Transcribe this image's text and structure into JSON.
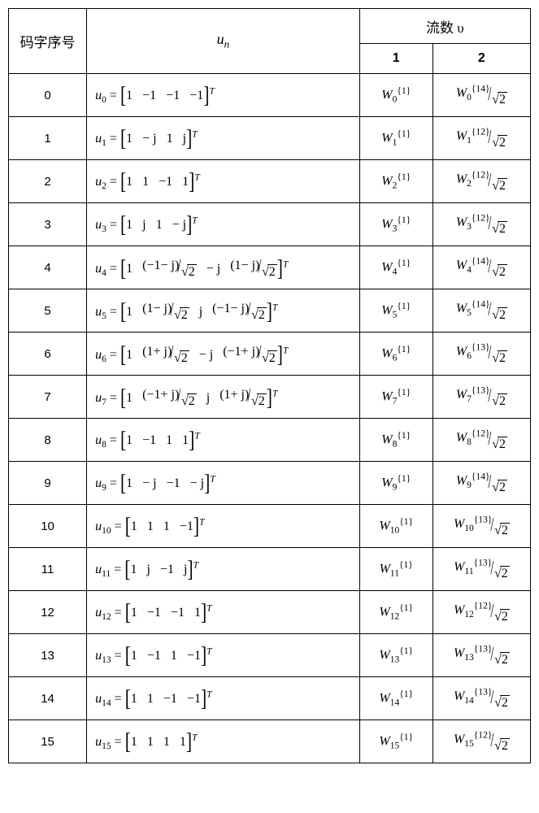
{
  "headers": {
    "index": "码字序号",
    "un": "u",
    "un_sub": "n",
    "flows_title": "流数 υ",
    "flow1": "1",
    "flow2": "2"
  },
  "sqrt2": "2",
  "rows": [
    {
      "idx": "0",
      "u_sub": "0",
      "vec": [
        "1",
        "−1",
        "−1",
        "−1"
      ],
      "T": "T",
      "f1_sub": "0",
      "f1_sup": "{1}",
      "f2_sub": "0",
      "f2_sup": "{14}"
    },
    {
      "idx": "1",
      "u_sub": "1",
      "vec": [
        "1",
        "− j",
        "1",
        "j"
      ],
      "T": "T",
      "f1_sub": "1",
      "f1_sup": "{1}",
      "f2_sub": "1",
      "f2_sup": "{12}"
    },
    {
      "idx": "2",
      "u_sub": "2",
      "vec": [
        "1",
        "1",
        "−1",
        "1"
      ],
      "T": "T",
      "f1_sub": "2",
      "f1_sup": "{1}",
      "f2_sub": "2",
      "f2_sup": "{12}"
    },
    {
      "idx": "3",
      "u_sub": "3",
      "vec": [
        "1",
        "j",
        "1",
        "− j"
      ],
      "T": "T",
      "f1_sub": "3",
      "f1_sup": "{1}",
      "f2_sub": "3",
      "f2_sup": "{12}"
    },
    {
      "idx": "4",
      "u_sub": "4",
      "vec_complex": [
        "1",
        "(−1− j)/√2",
        "− j",
        "(1− j)/√2"
      ],
      "T": "T",
      "f1_sub": "4",
      "f1_sup": "{1}",
      "f2_sub": "4",
      "f2_sup": "{14}"
    },
    {
      "idx": "5",
      "u_sub": "5",
      "vec_complex": [
        "1",
        "(1− j)/√2",
        "j",
        "(−1− j)/√2"
      ],
      "T": "T",
      "f1_sub": "5",
      "f1_sup": "{1}",
      "f2_sub": "5",
      "f2_sup": "{14}"
    },
    {
      "idx": "6",
      "u_sub": "6",
      "vec_complex": [
        "1",
        "(1+ j)/√2",
        "− j",
        "(−1+ j)/√2"
      ],
      "T": "T",
      "f1_sub": "6",
      "f1_sup": "{1}",
      "f2_sub": "6",
      "f2_sup": "{13}"
    },
    {
      "idx": "7",
      "u_sub": "7",
      "vec_complex": [
        "1",
        "(−1+ j)/√2",
        "j",
        "(1+ j)/√2"
      ],
      "T": "T",
      "f1_sub": "7",
      "f1_sup": "{1}",
      "f2_sub": "7",
      "f2_sup": "{13}"
    },
    {
      "idx": "8",
      "u_sub": "8",
      "vec": [
        "1",
        "−1",
        "1",
        "1"
      ],
      "T": "T",
      "f1_sub": "8",
      "f1_sup": "{1}",
      "f2_sub": "8",
      "f2_sup": "{12}"
    },
    {
      "idx": "9",
      "u_sub": "9",
      "vec": [
        "1",
        "− j",
        "−1",
        "− j"
      ],
      "T": "T",
      "f1_sub": "9",
      "f1_sup": "{1}",
      "f2_sub": "9",
      "f2_sup": "{14}"
    },
    {
      "idx": "10",
      "u_sub": "10",
      "vec": [
        "1",
        "1",
        "1",
        "−1"
      ],
      "T": "T",
      "f1_sub": "10",
      "f1_sup": "{1}",
      "f2_sub": "10",
      "f2_sup": "{13}"
    },
    {
      "idx": "11",
      "u_sub": "11",
      "vec": [
        "1",
        "j",
        "−1",
        "j"
      ],
      "T": "T",
      "f1_sub": "11",
      "f1_sup": "{1}",
      "f2_sub": "11",
      "f2_sup": "{13}"
    },
    {
      "idx": "12",
      "u_sub": "12",
      "vec": [
        "1",
        "−1",
        "−1",
        "1"
      ],
      "T": "T",
      "f1_sub": "12",
      "f1_sup": "{1}",
      "f2_sub": "12",
      "f2_sup": "{12}"
    },
    {
      "idx": "13",
      "u_sub": "13",
      "vec": [
        "1",
        "−1",
        "1",
        "−1"
      ],
      "T": "T",
      "f1_sub": "13",
      "f1_sup": "{1}",
      "f2_sub": "13",
      "f2_sup": "{13}"
    },
    {
      "idx": "14",
      "u_sub": "14",
      "vec": [
        "1",
        "1",
        "−1",
        "−1"
      ],
      "T": "T",
      "f1_sub": "14",
      "f1_sup": "{1}",
      "f2_sub": "14",
      "f2_sup": "{13}"
    },
    {
      "idx": "15",
      "u_sub": "15",
      "vec": [
        "1",
        "1",
        "1",
        "1"
      ],
      "T": "T",
      "f1_sub": "15",
      "f1_sup": "{1}",
      "f2_sub": "15",
      "f2_sup": "{12}"
    }
  ]
}
